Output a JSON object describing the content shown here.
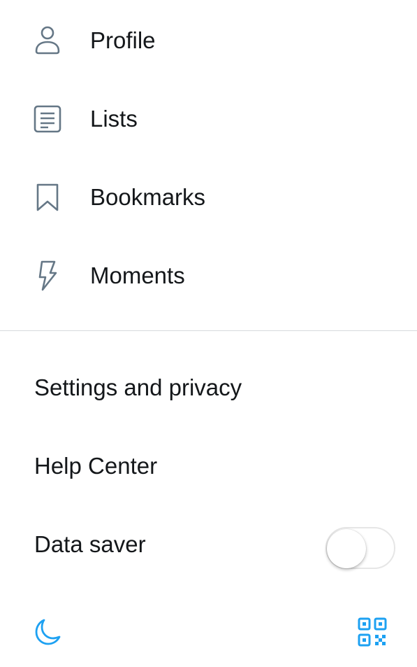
{
  "menu": {
    "items": [
      {
        "label": "Profile",
        "icon": "person-icon"
      },
      {
        "label": "Lists",
        "icon": "list-icon"
      },
      {
        "label": "Bookmarks",
        "icon": "bookmark-icon"
      },
      {
        "label": "Moments",
        "icon": "lightning-icon"
      }
    ]
  },
  "settings": {
    "items": [
      {
        "label": "Settings and privacy"
      },
      {
        "label": "Help Center"
      },
      {
        "label": "Data saver",
        "toggle_state": "off"
      }
    ]
  },
  "footer": {
    "left_icon": "moon-icon",
    "right_icon": "qr-code-icon"
  },
  "colors": {
    "text": "#14171a",
    "icon_gray": "#657786",
    "accent": "#1da1f2",
    "divider": "#d6dadd"
  }
}
